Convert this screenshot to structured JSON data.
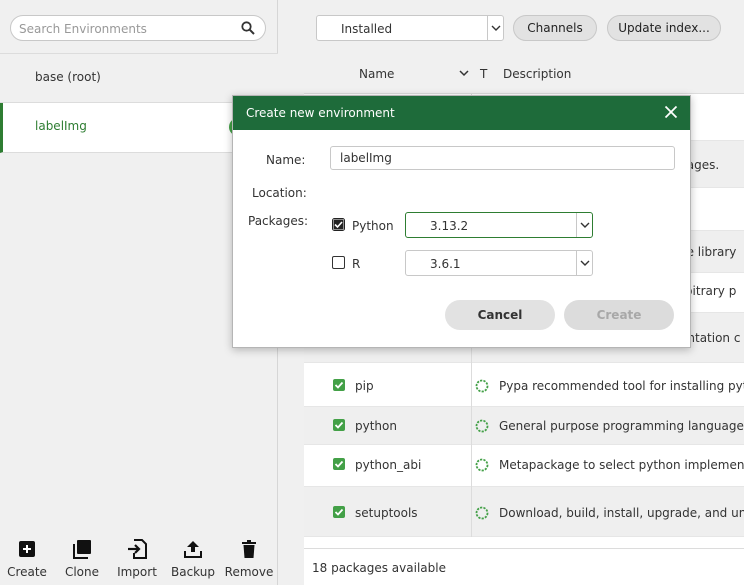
{
  "sidebar": {
    "search_placeholder": "Search Environments",
    "environments": [
      {
        "label": "base (root)"
      },
      {
        "label": "labelImg"
      }
    ],
    "toolbar": [
      {
        "label": "Create",
        "icon": "plus-box-icon"
      },
      {
        "label": "Clone",
        "icon": "clone-icon"
      },
      {
        "label": "Import",
        "icon": "import-icon"
      },
      {
        "label": "Backup",
        "icon": "upload-icon"
      },
      {
        "label": "Remove",
        "icon": "trash-icon"
      }
    ]
  },
  "main": {
    "filter_value": "Installed",
    "channels_label": "Channels",
    "update_label": "Update index...",
    "columns": {
      "name": "Name",
      "type": "T",
      "description": "Description"
    },
    "background_fragments": [
      "kages.",
      "ce library",
      "rbitrary p",
      "entation c"
    ],
    "packages": [
      {
        "name": "pip",
        "description": "Pypa recommended tool for installing pytho"
      },
      {
        "name": "python",
        "description": "General purpose programming language"
      },
      {
        "name": "python_abi",
        "description": "Metapackage to select python implementat"
      },
      {
        "name": "setuptools",
        "description": "Download, build, install, upgrade, and uninst"
      }
    ],
    "footer_text": "18 packages available"
  },
  "dialog": {
    "title": "Create new environment",
    "name_label": "Name:",
    "name_value": "labelImg",
    "location_label": "Location:",
    "packages_label": "Packages:",
    "python_label": "Python",
    "python_checked": true,
    "python_version": "3.13.2",
    "r_label": "R",
    "r_checked": false,
    "r_version": "3.6.1",
    "cancel_label": "Cancel",
    "create_label": "Create"
  },
  "colors": {
    "accent_green": "#1e6b3a",
    "check_green": "#43a047"
  }
}
